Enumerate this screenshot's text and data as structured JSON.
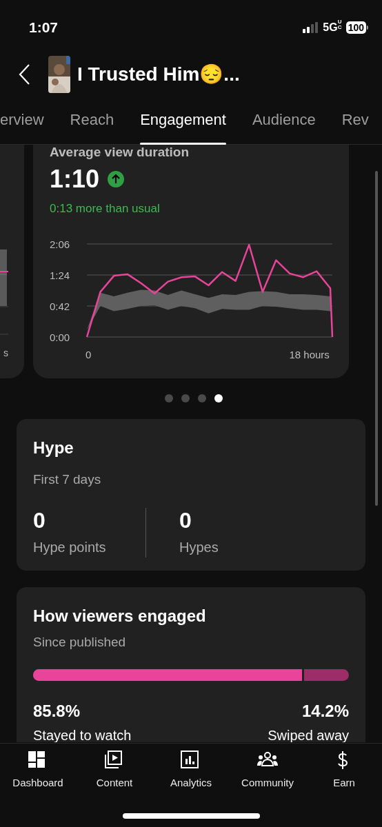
{
  "status_bar": {
    "time": "1:07",
    "network": "5G",
    "network_sup": "UC",
    "battery": "100"
  },
  "header": {
    "title": "I Trusted Him😔..."
  },
  "tabs": [
    {
      "label": "erview",
      "selected": false
    },
    {
      "label": "Reach",
      "selected": false
    },
    {
      "label": "Engagement",
      "selected": true
    },
    {
      "label": "Audience",
      "selected": false
    },
    {
      "label": "Rev",
      "selected": false
    }
  ],
  "previous_card": {
    "axis_label_fragment": "s"
  },
  "avd_card": {
    "title": "Average view duration",
    "value": "1:10",
    "trend": {
      "kind": "up"
    },
    "comparison": "0:13 more than usual",
    "chart_data": {
      "type": "line",
      "x": [
        0,
        1.09,
        2.19,
        3.28,
        4.37,
        5.47,
        6.56,
        7.66,
        8.75,
        9.84,
        10.94,
        12.03,
        13.12,
        14.22,
        15.31,
        16.41,
        17.5,
        18.59,
        19.69,
        19.86
      ],
      "xlim": [
        0,
        19.86
      ],
      "series": [
        {
          "color": "#e8449a",
          "values": [
            0,
            61,
            83,
            85,
            73,
            59,
            75,
            81,
            82,
            70,
            88,
            76,
            125,
            61,
            104,
            86,
            81,
            89,
            66,
            0
          ]
        }
      ],
      "ylim": [
        0,
        126
      ],
      "yticks": [
        {
          "value": 0,
          "label": "0:00"
        },
        {
          "value": 42,
          "label": "0:42"
        },
        {
          "value": 84,
          "label": "1:24"
        },
        {
          "value": 126,
          "label": "2:06"
        }
      ],
      "xticks": [
        {
          "value": 0,
          "label": "0"
        },
        {
          "value": 18,
          "label": "18 hours"
        }
      ]
    }
  },
  "pager": [
    {
      "selected": false
    },
    {
      "selected": false
    },
    {
      "selected": false
    },
    {
      "selected": true
    }
  ],
  "hype_card": {
    "title": "Hype",
    "subtitle": "First 7 days",
    "stats": [
      {
        "value": "0",
        "label": "Hype points"
      },
      {
        "value": "0",
        "label": "Hypes"
      }
    ]
  },
  "engaged_card": {
    "title": "How viewers engaged",
    "subtitle": "Since published",
    "level": 0.858,
    "stats": [
      {
        "value": "85.8%",
        "label": "Stayed to watch"
      },
      {
        "value": "14.2%",
        "label": "Swiped away"
      }
    ]
  },
  "nav": [
    {
      "kind": "dashboard",
      "label": "Dashboard"
    },
    {
      "kind": "content",
      "label": "Content"
    },
    {
      "kind": "analytics",
      "label": "Analytics"
    },
    {
      "kind": "community",
      "label": "Community"
    },
    {
      "kind": "earn",
      "label": "Earn"
    }
  ]
}
